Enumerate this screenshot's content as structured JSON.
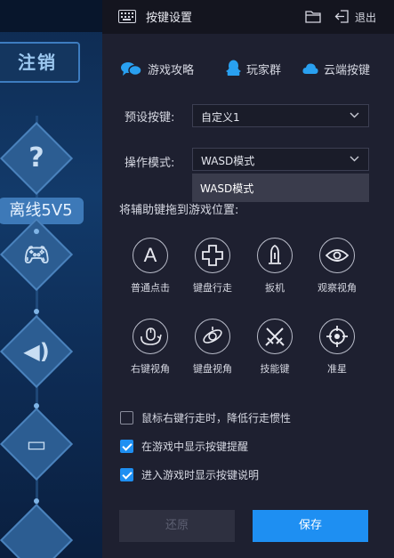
{
  "background": {
    "logout_label": "注销",
    "offline_label": "离线5V5"
  },
  "titlebar": {
    "title": "按键设置",
    "exit_label": "退出"
  },
  "links": [
    {
      "label": "游戏攻略",
      "icon": "chat-bubbles-icon"
    },
    {
      "label": "玩家群",
      "icon": "penguin-icon"
    },
    {
      "label": "云端按键",
      "icon": "cloud-icon"
    }
  ],
  "preset": {
    "label": "预设按键:",
    "value": "自定义1"
  },
  "mode": {
    "label": "操作模式:",
    "value": "WASD模式",
    "dropdown_option": "WASD模式"
  },
  "drag_hint": "将辅助键拖到游戏位置:",
  "keys": [
    {
      "label": "普通点击",
      "icon": "letter-a-icon"
    },
    {
      "label": "键盘行走",
      "icon": "dpad-icon"
    },
    {
      "label": "扳机",
      "icon": "bullet-icon"
    },
    {
      "label": "观察视角",
      "icon": "eye-icon"
    },
    {
      "label": "右键视角",
      "icon": "mouse-rotate-icon"
    },
    {
      "label": "键盘视角",
      "icon": "orbit-rotate-icon"
    },
    {
      "label": "技能键",
      "icon": "crossed-swords-icon"
    },
    {
      "label": "准星",
      "icon": "crosshair-icon"
    }
  ],
  "options": [
    {
      "label": "鼠标右键行走时，降低行走惯性",
      "checked": false
    },
    {
      "label": "在游戏中显示按键提醒",
      "checked": true
    },
    {
      "label": "进入游戏时显示按键说明",
      "checked": true
    }
  ],
  "buttons": {
    "restore": "还原",
    "save": "保存"
  },
  "colors": {
    "accent": "#1e8ff2",
    "panel_bg": "#1e2030",
    "titlebar_bg": "#14151f",
    "link_icon": "#29a0f0"
  }
}
